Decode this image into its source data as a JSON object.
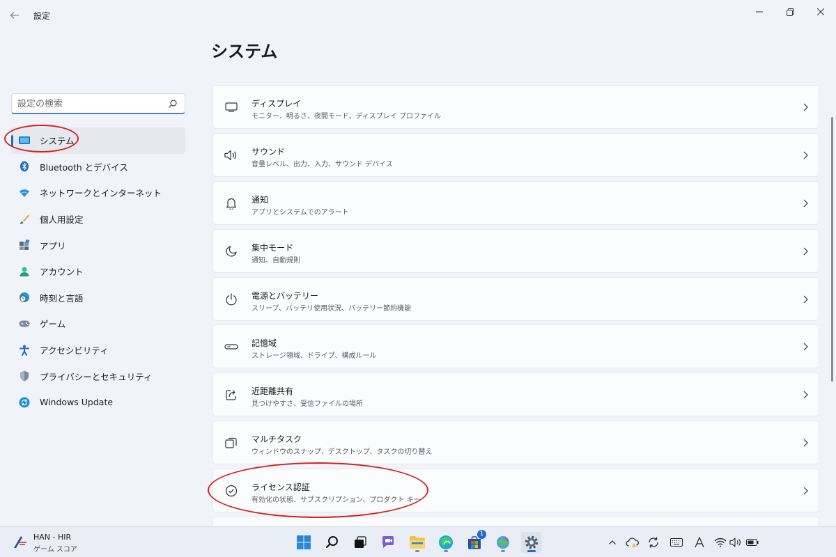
{
  "window": {
    "title": "設定"
  },
  "search": {
    "placeholder": "設定の検索",
    "value": ""
  },
  "nav": {
    "items": [
      {
        "label": "システム",
        "icon": "monitor-icon",
        "selected": true
      },
      {
        "label": "Bluetooth とデバイス",
        "icon": "bluetooth-icon"
      },
      {
        "label": "ネットワークとインターネット",
        "icon": "wifi-icon"
      },
      {
        "label": "個人用設定",
        "icon": "brush-icon"
      },
      {
        "label": "アプリ",
        "icon": "apps-icon"
      },
      {
        "label": "アカウント",
        "icon": "person-icon"
      },
      {
        "label": "時刻と言語",
        "icon": "globe-clock-icon"
      },
      {
        "label": "ゲーム",
        "icon": "gamepad-icon"
      },
      {
        "label": "アクセシビリティ",
        "icon": "accessibility-icon"
      },
      {
        "label": "プライバシーとセキュリティ",
        "icon": "shield-icon"
      },
      {
        "label": "Windows Update",
        "icon": "update-icon"
      }
    ]
  },
  "main": {
    "title": "システム",
    "cards": [
      {
        "title": "ディスプレイ",
        "subtitle": "モニター、明るさ、夜間モード、ディスプレイ プロファイル",
        "icon": "display-icon"
      },
      {
        "title": "サウンド",
        "subtitle": "音量レベル、出力、入力、サウンド デバイス",
        "icon": "speaker-icon"
      },
      {
        "title": "通知",
        "subtitle": "アプリとシステムでのアラート",
        "icon": "bell-icon"
      },
      {
        "title": "集中モード",
        "subtitle": "通知、自動規則",
        "icon": "moon-icon"
      },
      {
        "title": "電源とバッテリー",
        "subtitle": "スリープ、バッテリ使用状況、バッテリー節約機能",
        "icon": "power-icon"
      },
      {
        "title": "記憶域",
        "subtitle": "ストレージ領域、ドライブ、構成ルール",
        "icon": "storage-icon"
      },
      {
        "title": "近距離共有",
        "subtitle": "見つけやすさ、受信ファイルの場所",
        "icon": "share-icon"
      },
      {
        "title": "マルチタスク",
        "subtitle": "ウィンドウのスナップ、デスクトップ、タスクの切り替え",
        "icon": "multitask-icon"
      },
      {
        "title": "ライセンス認証",
        "subtitle": "有効化の状態、サブスクリプション、プロダクト キー",
        "icon": "check-circle-icon"
      },
      {
        "title": "",
        "subtitle": "",
        "icon": ""
      }
    ]
  },
  "taskbar": {
    "game_title": "HAN - HIR",
    "game_subtitle": "ゲーム スコア",
    "store_badge": "1"
  },
  "colors": {
    "accent": "#1f6bc7",
    "annotation": "#d9201d"
  }
}
